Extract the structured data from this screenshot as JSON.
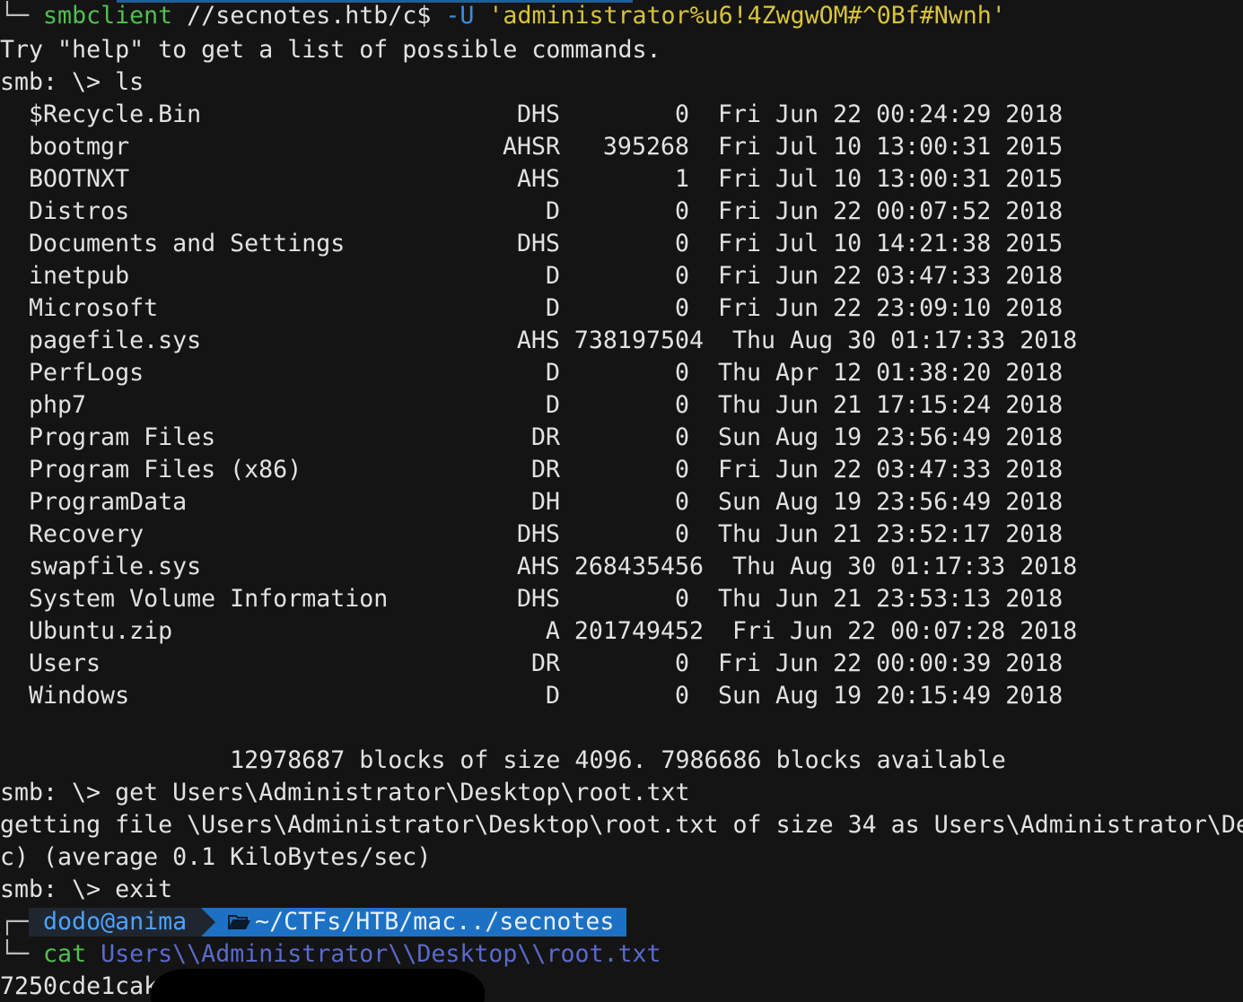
{
  "header_cmd": {
    "prompt_corner": "└─",
    "program": "smbclient",
    "target": " //secnotes.htb/c$ ",
    "flag": "-U",
    "credential": " 'administrator%u6!4ZwgwOM#^0Bf#Nwnh'"
  },
  "line_help": "Try \"help\" to get a list of possible commands.",
  "line_ls": "smb: \\> ls",
  "listing": [
    {
      "name": "$Recycle.Bin",
      "attr": "DHS",
      "size": "0",
      "date": "Fri Jun 22 00:24:29 2018"
    },
    {
      "name": "bootmgr",
      "attr": "AHSR",
      "size": "395268",
      "date": "Fri Jul 10 13:00:31 2015"
    },
    {
      "name": "BOOTNXT",
      "attr": "AHS",
      "size": "1",
      "date": "Fri Jul 10 13:00:31 2015"
    },
    {
      "name": "Distros",
      "attr": "D",
      "size": "0",
      "date": "Fri Jun 22 00:07:52 2018"
    },
    {
      "name": "Documents and Settings",
      "attr": "DHS",
      "size": "0",
      "date": "Fri Jul 10 14:21:38 2015"
    },
    {
      "name": "inetpub",
      "attr": "D",
      "size": "0",
      "date": "Fri Jun 22 03:47:33 2018"
    },
    {
      "name": "Microsoft",
      "attr": "D",
      "size": "0",
      "date": "Fri Jun 22 23:09:10 2018"
    },
    {
      "name": "pagefile.sys",
      "attr": "AHS 738197504",
      "size": "",
      "date": " Thu Aug 30 01:17:33 2018"
    },
    {
      "name": "PerfLogs",
      "attr": "D",
      "size": "0",
      "date": "Thu Apr 12 01:38:20 2018"
    },
    {
      "name": "php7",
      "attr": "D",
      "size": "0",
      "date": "Thu Jun 21 17:15:24 2018"
    },
    {
      "name": "Program Files",
      "attr": "DR",
      "size": "0",
      "date": "Sun Aug 19 23:56:49 2018"
    },
    {
      "name": "Program Files (x86)",
      "attr": "DR",
      "size": "0",
      "date": "Fri Jun 22 03:47:33 2018"
    },
    {
      "name": "ProgramData",
      "attr": "DH",
      "size": "0",
      "date": "Sun Aug 19 23:56:49 2018"
    },
    {
      "name": "Recovery",
      "attr": "DHS",
      "size": "0",
      "date": "Thu Jun 21 23:52:17 2018"
    },
    {
      "name": "swapfile.sys",
      "attr": "AHS 268435456",
      "size": "",
      "date": " Thu Aug 30 01:17:33 2018"
    },
    {
      "name": "System Volume Information",
      "attr": "DHS",
      "size": "0",
      "date": "Thu Jun 21 23:53:13 2018"
    },
    {
      "name": "Ubuntu.zip",
      "attr": "A 201749452",
      "size": "",
      "date": " Fri Jun 22 00:07:28 2018"
    },
    {
      "name": "Users",
      "attr": "DR",
      "size": "0",
      "date": "Fri Jun 22 00:00:39 2018"
    },
    {
      "name": "Windows",
      "attr": "D",
      "size": "0",
      "date": "Sun Aug 19 20:15:49 2018"
    }
  ],
  "blocks_line": "                12978687 blocks of size 4096. 7986686 blocks available",
  "line_get": "smb: \\> get Users\\Administrator\\Desktop\\root.txt",
  "line_getting": "getting file \\Users\\Administrator\\Desktop\\root.txt of size 34 as Users\\Administrator\\De",
  "line_average": "c) (average 0.1 KiloBytes/sec)",
  "line_exit": "smb: \\> exit",
  "prompt": {
    "corner_top": "┌─",
    "user_host": "dodo@anima",
    "folder_icon": "folder-open-icon",
    "path": "~/CTFs/HTB/mac../secnotes",
    "corner_bottom": "└─",
    "cmd": "cat",
    "arg": " Users\\\\Administrator\\\\Desktop\\\\root.txt"
  },
  "output_hash": "7250cde1cak"
}
